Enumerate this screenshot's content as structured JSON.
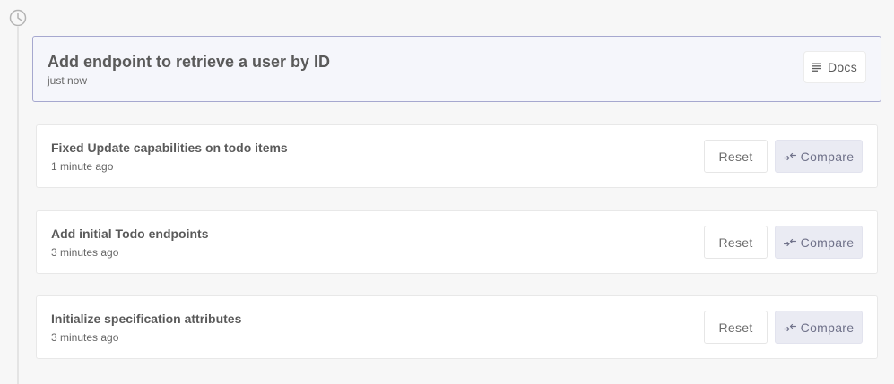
{
  "current": {
    "title": "Add endpoint to retrieve a user by ID",
    "time": "just now",
    "docs_label": "Docs",
    "docs_icon": "list-lines-icon"
  },
  "history": [
    {
      "title": "Fixed Update capabilities on todo items",
      "time": "1 minute ago",
      "reset_label": "Reset",
      "compare_label": "Compare"
    },
    {
      "title": "Add initial Todo endpoints",
      "time": "3 minutes ago",
      "reset_label": "Reset",
      "compare_label": "Compare"
    },
    {
      "title": "Initialize specification attributes",
      "time": "3 minutes ago",
      "reset_label": "Reset",
      "compare_label": "Compare"
    }
  ],
  "icons": {
    "timeline": "clock-icon",
    "compare": "compare-arrows-icon"
  },
  "colors": {
    "current_border": "#a6a8cf",
    "current_background": "#f5f6fb",
    "compare_background": "#eaebf3"
  }
}
